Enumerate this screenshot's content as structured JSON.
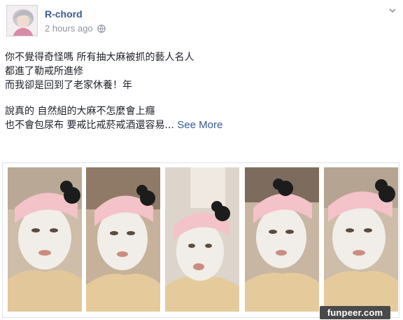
{
  "post": {
    "author": "R-chord",
    "timestamp": "2 hours ago",
    "privacy_icon": "globe-icon",
    "menu_icon": "chevron-down-icon",
    "body_lines": [
      "你不覺得奇怪嗎 所有抽大麻被抓的藝人名人",
      "都進了勒戒所進修",
      "而我卻是回到了老家休養！年",
      "說真的 自然組的大麻不怎麼會上癮",
      "也不會包尿布 要戒比戒菸戒酒還容易..."
    ],
    "see_more": "See More",
    "photos": [
      {
        "name": "photo-1"
      },
      {
        "name": "photo-2"
      },
      {
        "name": "photo-3"
      },
      {
        "name": "photo-4"
      },
      {
        "name": "photo-5"
      }
    ]
  },
  "watermark": "funpeer.com",
  "colors": {
    "link": "#365899",
    "name": "#3b5998",
    "meta": "#90949c",
    "text": "#1d2129"
  }
}
